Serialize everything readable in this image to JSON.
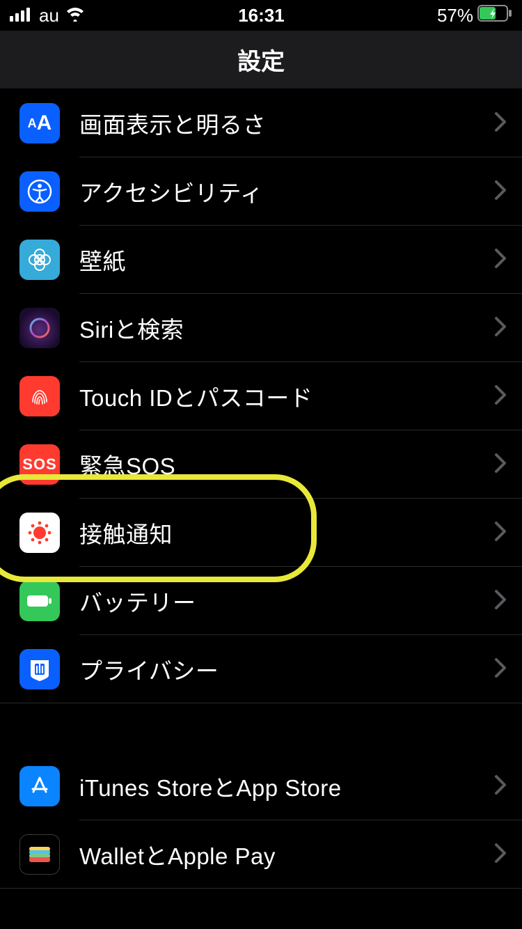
{
  "status": {
    "carrier": "au",
    "time": "16:31",
    "battery_pct": "57%"
  },
  "nav": {
    "title": "設定"
  },
  "rows": [
    {
      "label": "画面表示と明るさ",
      "icon": "text-size-icon",
      "bg": "#0a60ff"
    },
    {
      "label": "アクセシビリティ",
      "icon": "accessibility-icon",
      "bg": "#0a60ff"
    },
    {
      "label": "壁紙",
      "icon": "wallpaper-icon",
      "bg": "#36aad8"
    },
    {
      "label": "Siriと検索",
      "icon": "siri-icon",
      "bg": "#000000"
    },
    {
      "label": "Touch IDとパスコード",
      "icon": "fingerprint-icon",
      "bg": "#ff3b30"
    },
    {
      "label": "緊急SOS",
      "icon": "sos-icon",
      "bg": "#ff3b30"
    },
    {
      "label": "接触通知",
      "icon": "exposure-icon",
      "bg": "#ffffff"
    },
    {
      "label": "バッテリー",
      "icon": "battery-icon",
      "bg": "#34c759"
    },
    {
      "label": "プライバシー",
      "icon": "privacy-icon",
      "bg": "#0a60ff"
    }
  ],
  "rows2": [
    {
      "label": "iTunes StoreとApp Store",
      "icon": "appstore-icon",
      "bg": "#0a84ff"
    },
    {
      "label": "WalletとApple Pay",
      "icon": "wallet-icon",
      "bg": "#000000"
    }
  ]
}
